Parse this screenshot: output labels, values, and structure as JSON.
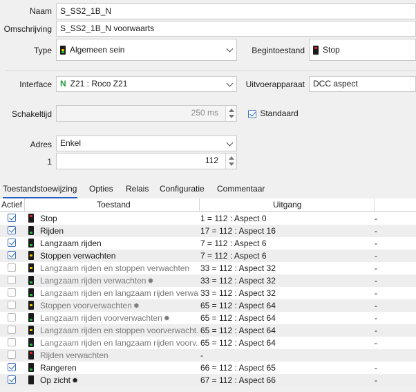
{
  "form": {
    "naam_label": "Naam",
    "naam_value": "S_SS2_1B_N",
    "omschrijving_label": "Omschrijving",
    "omschrijving_value": "S_SS2_1B_N voorwaarts",
    "type_label": "Type",
    "type_value": "Algemeen sein",
    "begintoestand_label": "Begintoestand",
    "begintoestand_value": "Stop",
    "interface_label": "Interface",
    "interface_icon_text": "N",
    "interface_value": "Z21 : Roco Z21",
    "uitvoerapparaat_label": "Uitvoerapparaat",
    "uitvoerapparaat_value": "DCC aspect",
    "schakeltijd_label": "Schakeltijd",
    "schakeltijd_value": "250 ms",
    "standaard_label": "Standaard",
    "adres_label": "Adres",
    "adres_value": "Enkel",
    "adres_index_label": "1",
    "adres_index_value": "112"
  },
  "tabs": [
    "Toestandstoewijzing",
    "Opties",
    "Relais",
    "Configuratie",
    "Commentaar"
  ],
  "table": {
    "headers": {
      "actief": "Actief",
      "toestand": "Toestand",
      "uitgang": "Uitgang"
    },
    "rows": [
      {
        "checked": true,
        "name": "Stop",
        "output": "1 = 112 : Aspect 0",
        "extra": "-",
        "signal": [
          "r",
          "off",
          "off"
        ],
        "star": false
      },
      {
        "checked": true,
        "name": "Rijden",
        "output": "17 = 112 : Aspect 16",
        "extra": "-",
        "signal": [
          "off",
          "off",
          "g"
        ],
        "star": false
      },
      {
        "checked": true,
        "name": "Langzaam rijden",
        "output": "7 = 112 : Aspect 6",
        "extra": "-",
        "signal": [
          "off",
          "off",
          "g"
        ],
        "star": false
      },
      {
        "checked": true,
        "name": "Stoppen verwachten",
        "output": "7 = 112 : Aspect 6",
        "extra": "-",
        "signal": [
          "off",
          "y",
          "off"
        ],
        "star": false
      },
      {
        "checked": false,
        "name": "Langzaam rijden en stoppen verwachten",
        "output": "33 = 112 : Aspect 32",
        "extra": "-",
        "signal": [
          "off",
          "y",
          "off"
        ],
        "star": false
      },
      {
        "checked": false,
        "name": "Langzaam rijden verwachten",
        "output": "33 = 112 : Aspect 32",
        "extra": "-",
        "signal": [
          "off",
          "off",
          "g"
        ],
        "star": true
      },
      {
        "checked": false,
        "name": "Langzaam rijden en langzaam rijden verwa...",
        "output": "33 = 112 : Aspect 32",
        "extra": "-",
        "signal": [
          "off",
          "off",
          "g"
        ],
        "star": false
      },
      {
        "checked": false,
        "name": "Stoppen voorverwachten",
        "output": "65 = 112 : Aspect 64",
        "extra": "-",
        "signal": [
          "off",
          "y",
          "off"
        ],
        "star": true
      },
      {
        "checked": false,
        "name": "Langzaam rijden voorverwachten",
        "output": "65 = 112 : Aspect 64",
        "extra": "-",
        "signal": [
          "off",
          "off",
          "g"
        ],
        "star": true
      },
      {
        "checked": false,
        "name": "Langzaam rijden en stoppen voorverwacht...",
        "output": "65 = 112 : Aspect 64",
        "extra": "-",
        "signal": [
          "off",
          "y",
          "off"
        ],
        "star": false
      },
      {
        "checked": false,
        "name": "Langzaam rijden en langzaam rijden voorv...",
        "output": "65 = 112 : Aspect 64",
        "extra": "-",
        "signal": [
          "off",
          "off",
          "g"
        ],
        "star": false
      },
      {
        "checked": false,
        "name": "Rijden verwachten",
        "output": "-",
        "extra": "",
        "signal": [
          "r",
          "off",
          "off"
        ],
        "star": false
      },
      {
        "checked": true,
        "name": "Rangeren",
        "output": "66 = 112 : Aspect 65",
        "extra": "-",
        "signal": [
          "off",
          "off",
          "g"
        ],
        "star": false
      },
      {
        "checked": true,
        "name": "Op zicht",
        "output": "67 = 112 : Aspect 66",
        "extra": "-",
        "signal": [
          "off",
          "off",
          "off"
        ],
        "star": true
      }
    ]
  },
  "colors": {
    "accent": "#1f5fbf",
    "signal_red": "#e0231c",
    "signal_yellow": "#f4c400",
    "signal_green": "#1fbf3a"
  }
}
